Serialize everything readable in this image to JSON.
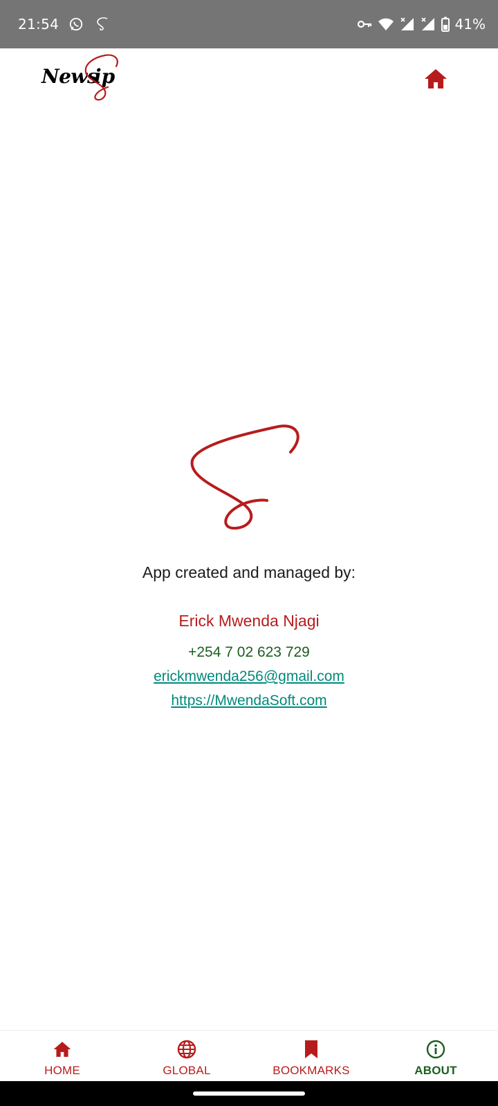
{
  "status_bar": {
    "time": "21:54",
    "battery": "41%",
    "icons": [
      "whatsapp-icon",
      "app-notification-icon",
      "vpn-key-icon",
      "wifi-icon",
      "signal-icon",
      "signal-icon",
      "battery-icon"
    ]
  },
  "app_bar": {
    "logo_text": "News",
    "logo_text_end": "ip",
    "action_icon": "home-icon"
  },
  "about": {
    "credit_title": "App created and managed by:",
    "author_name": "Erick Mwenda Njagi",
    "phone": "+254 7 02 623 729",
    "email": "erickmwenda256@gmail.com",
    "website": "https://MwendaSoft.com"
  },
  "bottom_nav": {
    "items": [
      {
        "label": "HOME",
        "icon": "home-icon",
        "active": false
      },
      {
        "label": "GLOBAL",
        "icon": "globe-icon",
        "active": false
      },
      {
        "label": "BOOKMARKS",
        "icon": "bookmark-icon",
        "active": false
      },
      {
        "label": "ABOUT",
        "icon": "info-icon",
        "active": true
      }
    ]
  },
  "colors": {
    "brand_red": "#b71c1c",
    "active_green": "#1b5e20",
    "link_teal": "#00897b",
    "status_bar": "#757575"
  }
}
